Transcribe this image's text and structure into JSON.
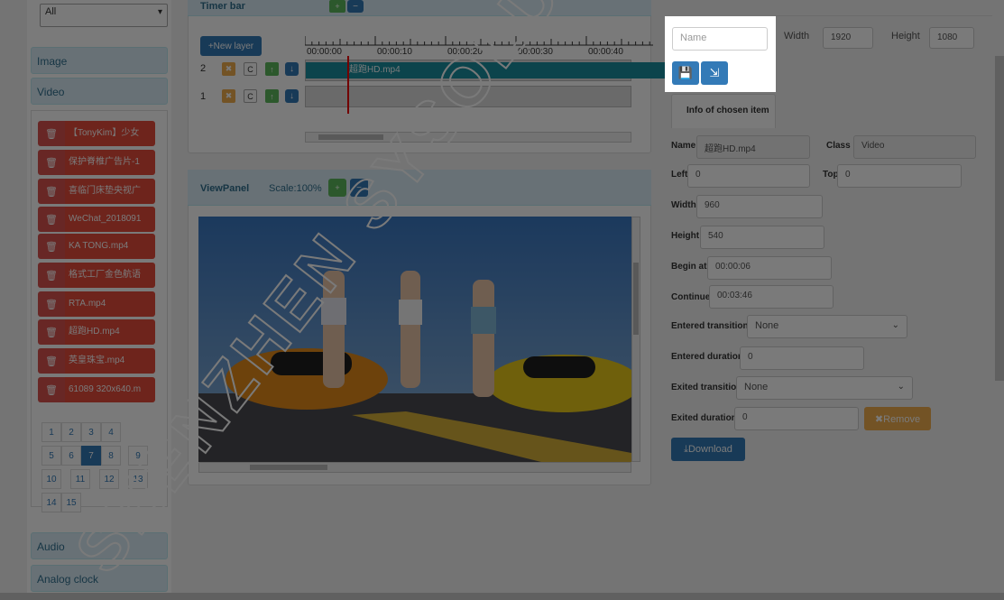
{
  "sidebar": {
    "filter_select": "All",
    "sections": {
      "image": "Image",
      "video": "Video",
      "audio": "Audio",
      "analog_clock": "Analog clock"
    },
    "video_files": [
      "【TonyKim】少女",
      "保护脊椎广告片-1",
      "喜临门床垫央视广",
      "WeChat_2018091",
      "KA TONG.mp4",
      "格式工厂金色航语",
      "RTA.mp4",
      "超跑HD.mp4",
      "英皇珠宝.mp4",
      "61089 320x640.m"
    ],
    "pages": [
      "1",
      "2",
      "3",
      "4",
      "5",
      "6",
      "7",
      "8",
      "9",
      "10",
      "11",
      "12",
      "13",
      "14",
      "15"
    ],
    "active_page": "7"
  },
  "timeline": {
    "header_title": "Timer bar",
    "new_layer_label": "+New layer",
    "ruler_ticks": [
      "00:00:00",
      "00:00:10",
      "00:00:20",
      "00:00:30",
      "00:00:40"
    ],
    "layers": [
      {
        "num": "2",
        "clip": "超跑HD.mp4"
      },
      {
        "num": "1",
        "clip": ""
      }
    ]
  },
  "view_panel": {
    "title": "ViewPanel",
    "scale": "Scale:100%"
  },
  "toolbar": {
    "name_placeholder": "Name",
    "width_label": "Width",
    "width_value": "1920",
    "height_label": "Height",
    "height_value": "1080"
  },
  "info": {
    "tab": "Info of chosen item",
    "name_label": "Name",
    "name_value": "超跑HD.mp4",
    "class_label": "Class",
    "class_value": "Video",
    "left_label": "Left",
    "left_value": "0",
    "top_label": "Top",
    "top_value": "0",
    "width_label": "Width",
    "width_value": "960",
    "height_label": "Height",
    "height_value": "540",
    "begin_label": "Begin at",
    "begin_value": "00:00:06",
    "continue_label": "Continue",
    "continue_value": "00:03:46",
    "entered_transition_label": "Entered transition",
    "entered_transition_value": "None",
    "entered_duration_label": "Entered duration",
    "entered_duration_value": "0",
    "exited_transition_label": "Exited transition",
    "exited_transition_value": "None",
    "exited_duration_label": "Exited duration",
    "exited_duration_value": "0",
    "remove_label": "✖Remove",
    "download_label": "Download"
  },
  "watermark": "SHENZHEN SYSOLUTION TECH",
  "colors": {
    "danger": "#d9534f",
    "primary": "#337ab7",
    "success": "#5cb85c",
    "warning": "#f0ad4e",
    "clip": "#1a8fa0",
    "panel_head": "#d9edf7"
  }
}
